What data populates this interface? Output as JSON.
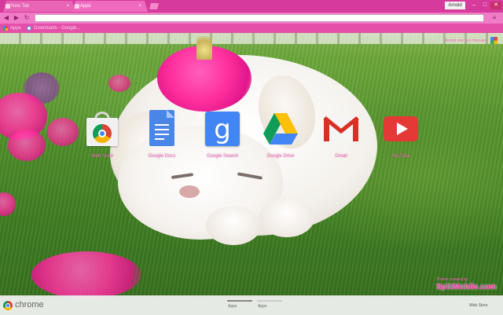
{
  "tabs": [
    {
      "label": "New Tab",
      "active": false
    },
    {
      "label": "Apps",
      "active": true
    }
  ],
  "window": {
    "user": "Arnold",
    "minimize": "–",
    "maximize": "□",
    "close": "✕"
  },
  "toolbar": {
    "back": "◀",
    "forward": "▶",
    "reload": "↻",
    "menu": "≡",
    "omnibox_value": ""
  },
  "bookmarks": [
    {
      "label": "Apps",
      "icon": "apps-grid-icon"
    },
    {
      "label": "Downloads - Google...",
      "icon": "google-favicon"
    }
  ],
  "attribution": "Arnold van den Hoeven",
  "apps": [
    {
      "label": "Web Store",
      "icon": "chrome-web-store-icon"
    },
    {
      "label": "Google Docs",
      "icon": "google-docs-icon"
    },
    {
      "label": "Google Search",
      "icon": "google-search-icon"
    },
    {
      "label": "Google Drive",
      "icon": "google-drive-icon"
    },
    {
      "label": "Gmail",
      "icon": "gmail-icon"
    },
    {
      "label": "YouTube",
      "icon": "youtube-icon"
    }
  ],
  "search_glyph": "g",
  "bottom": {
    "brand": "chrome",
    "pages": [
      "Apps",
      "Apps"
    ],
    "web_store": "Web Store"
  },
  "theme_credit": {
    "line1": "Theme created by",
    "brand": "SplitMobile.com"
  },
  "colors": {
    "accent": "#e54ea9",
    "tab_bar": "#d63a9b",
    "label_pink": "#ff6cc6"
  }
}
